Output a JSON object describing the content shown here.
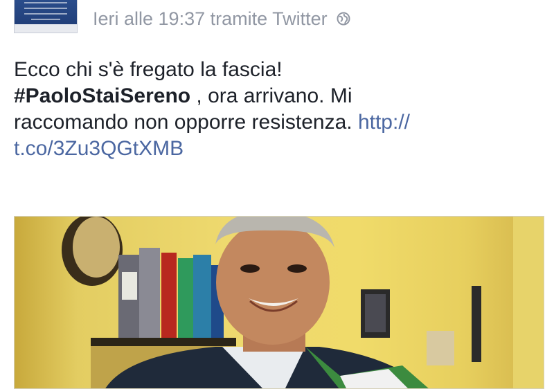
{
  "post": {
    "timestamp": "Ieri alle 19:37 tramite Twitter",
    "privacy_icon": "globe-icon",
    "text": {
      "line1": "Ecco chi s'è fregato la fascia!",
      "hashtag": "#PaoloStaiSereno",
      "line2_rest": " , ora arrivano. Mi",
      "line3_text": "raccomando non opporre resistenza. ",
      "link_part1": "http://",
      "link_part2": "t.co/3Zu3QGtXMB"
    },
    "photo_alt": "photo"
  },
  "colors": {
    "text": "#1d2129",
    "meta": "#9197a3",
    "link": "#4b67a1"
  }
}
